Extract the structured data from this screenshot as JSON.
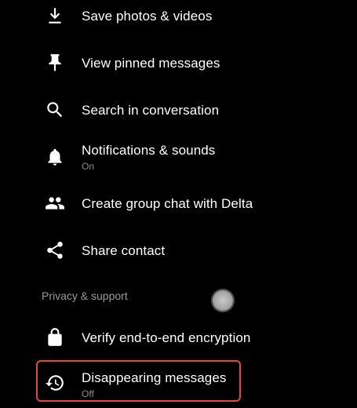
{
  "menu": {
    "items": [
      {
        "label": "Save photos & videos",
        "icon": "download-icon"
      },
      {
        "label": "View pinned messages",
        "icon": "pin-icon"
      },
      {
        "label": "Search in conversation",
        "icon": "search-icon"
      },
      {
        "label": "Notifications & sounds",
        "sub": "On",
        "icon": "bell-icon"
      },
      {
        "label": "Create group chat with Delta",
        "icon": "group-icon"
      },
      {
        "label": "Share contact",
        "icon": "share-icon"
      }
    ]
  },
  "privacy": {
    "header": "Privacy & support",
    "items": [
      {
        "label": "Verify end-to-end encryption",
        "icon": "lock-icon"
      },
      {
        "label": "Disappearing messages",
        "sub": "Off",
        "icon": "history-timer-icon"
      }
    ]
  },
  "colors": {
    "background": "#000000",
    "text": "#ffffff",
    "subtext": "#8c8c8c",
    "highlight": "#e8453c"
  }
}
